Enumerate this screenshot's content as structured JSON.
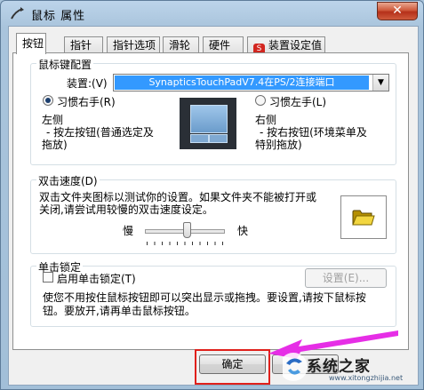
{
  "window": {
    "title": "鼠标 属性",
    "close_label": "✕"
  },
  "tabs": [
    "按钮",
    "指针",
    "指针选项",
    "滑轮",
    "硬件",
    "装置设定值"
  ],
  "button_config": {
    "group_title": "鼠标键配置",
    "device_label": "装置:(V)",
    "device_value": "SynapticsTouchPadV7.4在PS/2连接端口",
    "right_handed_label": "习惯右手(R)",
    "left_handed_label": "习惯左手(L)",
    "right_handed_selected": true,
    "left_side_title": "左侧",
    "left_side_desc_1": "- 按左按钮(普通选定及",
    "left_side_desc_2": "拖放)",
    "right_side_title": "右侧",
    "right_side_desc_1": "- 按右按钮(环境菜单及",
    "right_side_desc_2": "特别拖放)"
  },
  "double_click": {
    "group_title": "双击速度(D)",
    "desc_1": "双击文件夹图标以测试你的设置。如果文件夹不能被打开或",
    "desc_2": "关闭,请尝试用较慢的双击速度设定。",
    "slow_label": "慢",
    "fast_label": "快",
    "speed_fraction": 0.5,
    "folder_icon": "folder-icon"
  },
  "click_lock": {
    "group_title": "单击锁定",
    "checkbox_label": "启用单击锁定(T)",
    "checked": false,
    "settings_button": "设置(E)...",
    "desc_1": "使您不用按住鼠标按钮即可以突出显示或拖拽。要设置,请按下鼠标按",
    "desc_2": "钮。要放开,请再单击鼠标按钮。"
  },
  "footer": {
    "ok_label": "确定"
  },
  "watermark": {
    "text": "系统之家",
    "url": "www.xitongzhijia.net"
  },
  "colors": {
    "highlight": "#3399ff",
    "annotation_red": "#e0201b",
    "arrow_magenta": "#e62ee6"
  }
}
